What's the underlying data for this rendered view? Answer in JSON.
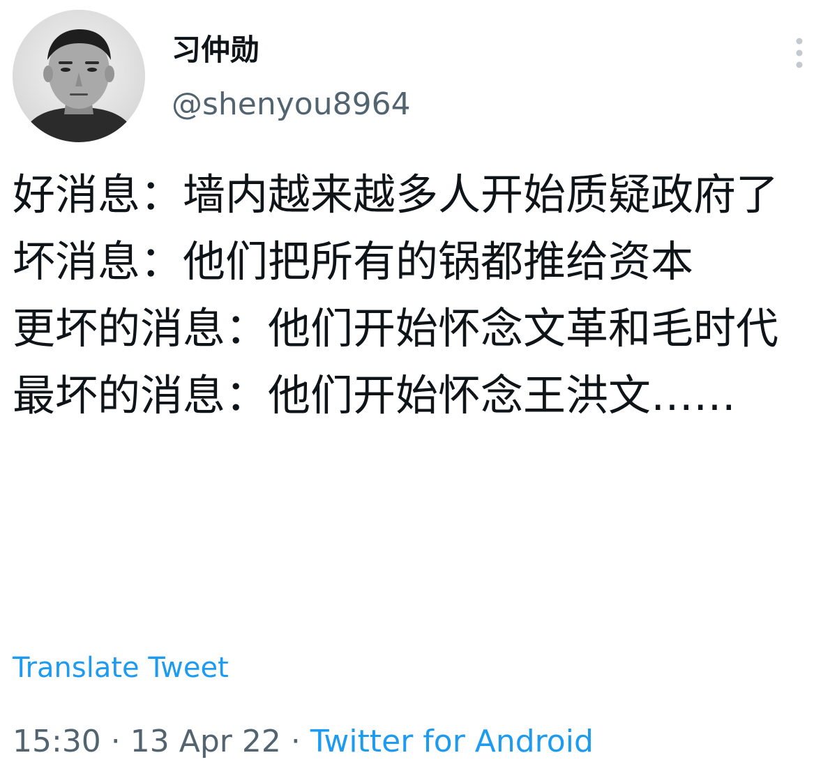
{
  "author": {
    "display_name": "习仲勋",
    "handle": "@shenyou8964",
    "avatar_icon": "profile-photo"
  },
  "menu": {
    "icon": "more-vertical-icon"
  },
  "tweet": {
    "text": "好消息：墙内越来越多人开始质疑政府了\n坏消息：他们把所有的锅都推给资本\n更坏的消息：他们开始怀念文革和毛时代\n最坏的消息：他们开始怀念王洪文……"
  },
  "translate_label": "Translate Tweet",
  "meta": {
    "time": "15:30",
    "separator": " · ",
    "date": "13 Apr 22",
    "source": "Twitter for Android"
  },
  "colors": {
    "link": "#1d9bf0",
    "secondary": "#536471",
    "text": "#0f1419"
  }
}
